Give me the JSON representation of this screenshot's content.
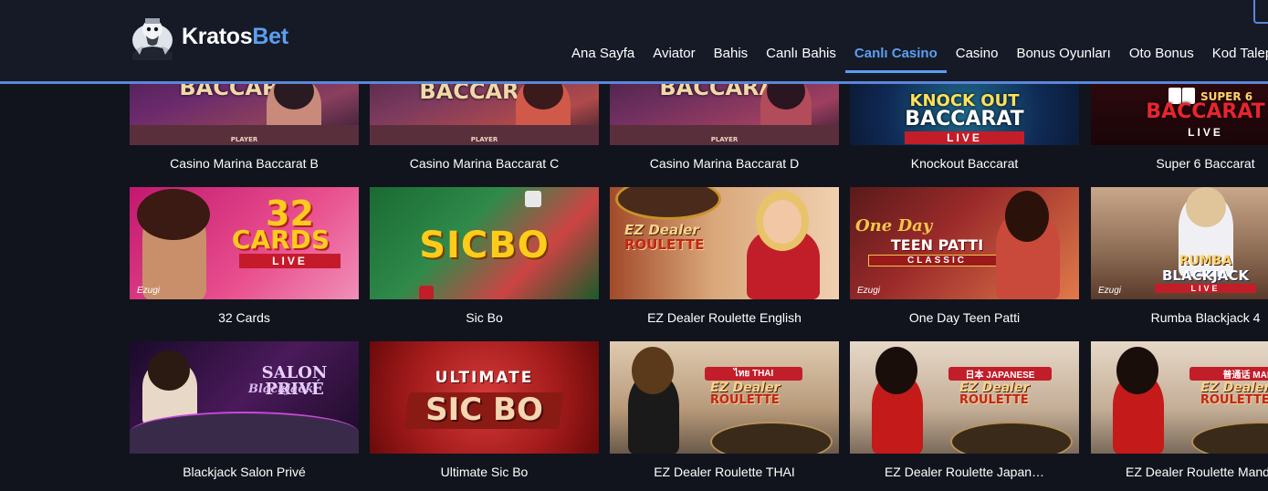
{
  "brand": {
    "name_part1": "Kratos",
    "name_part2": "Bet"
  },
  "nav": {
    "items": [
      "Ana Sayfa",
      "Aviator",
      "Bahis",
      "Canlı Bahis",
      "Canlı Casino",
      "Casino",
      "Bonus Oyunları",
      "Oto Bonus",
      "Kod Talep"
    ],
    "active": "Canlı Casino"
  },
  "games": {
    "row1": [
      "Casino Marina Baccarat B",
      "Casino Marina Baccarat C",
      "Casino Marina Baccarat D",
      "Knockout Baccarat",
      "Super 6 Baccarat"
    ],
    "row2": [
      "32 Cards",
      "Sic Bo",
      "EZ Dealer Roulette English",
      "One Day Teen Patti",
      "Rumba Blackjack 4"
    ],
    "row3": [
      "Blackjack Salon Privé",
      "Ultimate Sic Bo",
      "EZ Dealer Roulette THAI",
      "EZ Dealer Roulette Japan…",
      "EZ Dealer Roulette Manda"
    ]
  },
  "thumb_text": {
    "baccarat": "BACCARAT",
    "player": "PLAYER",
    "knockout_top": "KNOCK OUT",
    "knockout_mid": "BACCARAT",
    "live": "LIVE",
    "super6_top": "SUPER 6",
    "super6_mid": "BACCARAT",
    "cards_num": "32",
    "cards_word": "CARDS",
    "sicbo": "SICBO",
    "ez_dealer": "EZ Dealer",
    "roulette": "ROULETTE",
    "one_day": "One Day",
    "teen_patti": "TEEN PATTI",
    "classic": "CLASSIC",
    "rumba": "RUMBA",
    "blackjack": "BLACKJACK",
    "salon_prive": "SALON PRIVÉ",
    "blackjack_script": "Blackjack",
    "ultimate": "ULTIMATE",
    "sic_bo": "SIC BO",
    "thai": "ไทย THAI",
    "japanese": "日本 JAPANESE",
    "mandarin": "普通话 MANDA",
    "ezugi": "Ezugi"
  },
  "colors": {
    "accent": "#5b9ff0",
    "background": "#11141d",
    "header": "#161a27"
  }
}
